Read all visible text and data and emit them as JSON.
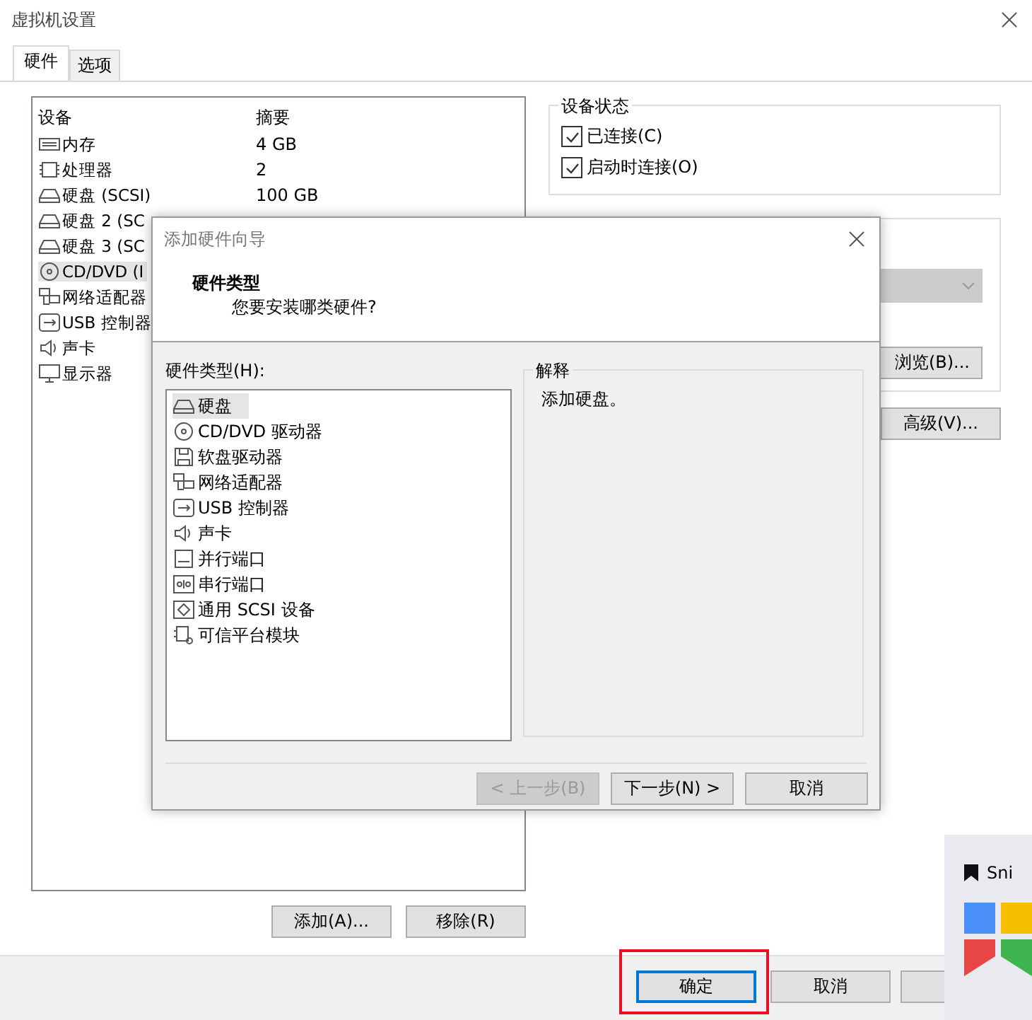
{
  "window": {
    "title": "虚拟机设置"
  },
  "tabs": [
    {
      "label": "硬件",
      "selected": true
    },
    {
      "label": "选项",
      "selected": false
    }
  ],
  "device_list": {
    "columns": [
      "设备",
      "摘要"
    ],
    "rows": [
      {
        "kind": "memory",
        "device": "内存",
        "summary": "4 GB",
        "selected": false
      },
      {
        "kind": "cpu",
        "device": "处理器",
        "summary": "2",
        "selected": false
      },
      {
        "kind": "disk",
        "device": "硬盘 (SCSI)",
        "summary": "100 GB",
        "selected": false
      },
      {
        "kind": "disk",
        "device": "硬盘 2 (SC",
        "selected": false
      },
      {
        "kind": "disk",
        "device": "硬盘 3 (SC",
        "selected": false
      },
      {
        "kind": "cdrom",
        "device": "CD/DVD (I",
        "selected": true
      },
      {
        "kind": "network",
        "device": "网络适配器",
        "selected": false
      },
      {
        "kind": "usb",
        "device": "USB 控制器",
        "selected": false
      },
      {
        "kind": "sound",
        "device": "声卡",
        "selected": false
      },
      {
        "kind": "display",
        "device": "显示器",
        "selected": false
      }
    ]
  },
  "list_buttons": [
    "添加(A)...",
    "移除(R)"
  ],
  "device_status": {
    "title": "设备状态",
    "checkboxes": [
      {
        "label": "已连接(C)",
        "checked": true
      },
      {
        "label": "启动时连接(O)",
        "checked": true
      }
    ]
  },
  "connection": {
    "dropdown": {
      "disabled": true
    },
    "browse_button": "浏览(B)..."
  },
  "advanced_button": "高级(V)...",
  "footer_buttons": [
    {
      "label": "确定",
      "focused": true
    },
    {
      "label": "取消",
      "focused": false
    }
  ],
  "wizard": {
    "title": "添加硬件向导",
    "heading": "硬件类型",
    "subheading": "您要安装哪类硬件?",
    "list_label": "硬件类型(H):",
    "items": [
      {
        "kind": "disk",
        "label": "硬盘",
        "selected": true
      },
      {
        "kind": "cdrom",
        "label": "CD/DVD 驱动器",
        "selected": false
      },
      {
        "kind": "floppy",
        "label": "软盘驱动器",
        "selected": false
      },
      {
        "kind": "network",
        "label": "网络适配器",
        "selected": false
      },
      {
        "kind": "usb",
        "label": "USB 控制器",
        "selected": false
      },
      {
        "kind": "sound",
        "label": "声卡",
        "selected": false
      },
      {
        "kind": "parallel",
        "label": "并行端口",
        "selected": false
      },
      {
        "kind": "serial",
        "label": "串行端口",
        "selected": false
      },
      {
        "kind": "scsi",
        "label": "通用 SCSI 设备",
        "selected": false
      },
      {
        "kind": "tpm",
        "label": "可信平台模块",
        "selected": false
      }
    ],
    "explanation": {
      "title": "解释",
      "text": "添加硬盘。"
    },
    "buttons": [
      {
        "label": "< 上一步(B)",
        "disabled": true
      },
      {
        "label": "下一步(N) >",
        "disabled": false
      },
      {
        "label": "取消",
        "disabled": false
      }
    ]
  },
  "snip": {
    "label": "Sni"
  }
}
